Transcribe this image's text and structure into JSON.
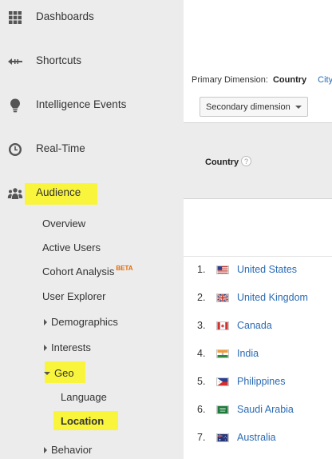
{
  "sidebar": {
    "items": [
      {
        "label": "Dashboards",
        "icon": "grid-icon"
      },
      {
        "label": "Shortcuts",
        "icon": "shortcut-arrow-icon"
      },
      {
        "label": "Intelligence Events",
        "icon": "lightbulb-icon"
      },
      {
        "label": "Real-Time",
        "icon": "clock-icon"
      },
      {
        "label": "Audience",
        "icon": "people-icon"
      }
    ],
    "audience_sub": {
      "overview": "Overview",
      "active_users": "Active Users",
      "cohort_analysis": "Cohort Analysis",
      "beta_badge": "BETA",
      "user_explorer": "User Explorer",
      "demographics": "Demographics",
      "interests": "Interests",
      "geo": "Geo",
      "language": "Language",
      "location": "Location",
      "behavior": "Behavior"
    },
    "highlight_color": "#f9f53c"
  },
  "report": {
    "primary_dimension_label": "Primary Dimension:",
    "primary_dimension_current": "Country",
    "primary_dimension_alt": "City",
    "secondary_dimension_button": "Secondary dimension",
    "column_header": "Country",
    "help_glyph": "?",
    "rows": [
      {
        "rank": "1.",
        "country": "United States",
        "flag": "us"
      },
      {
        "rank": "2.",
        "country": "United Kingdom",
        "flag": "gb"
      },
      {
        "rank": "3.",
        "country": "Canada",
        "flag": "ca"
      },
      {
        "rank": "4.",
        "country": "India",
        "flag": "in"
      },
      {
        "rank": "5.",
        "country": "Philippines",
        "flag": "ph"
      },
      {
        "rank": "6.",
        "country": "Saudi Arabia",
        "flag": "sa"
      },
      {
        "rank": "7.",
        "country": "Australia",
        "flag": "au"
      }
    ],
    "link_color": "#2a6bb5"
  }
}
